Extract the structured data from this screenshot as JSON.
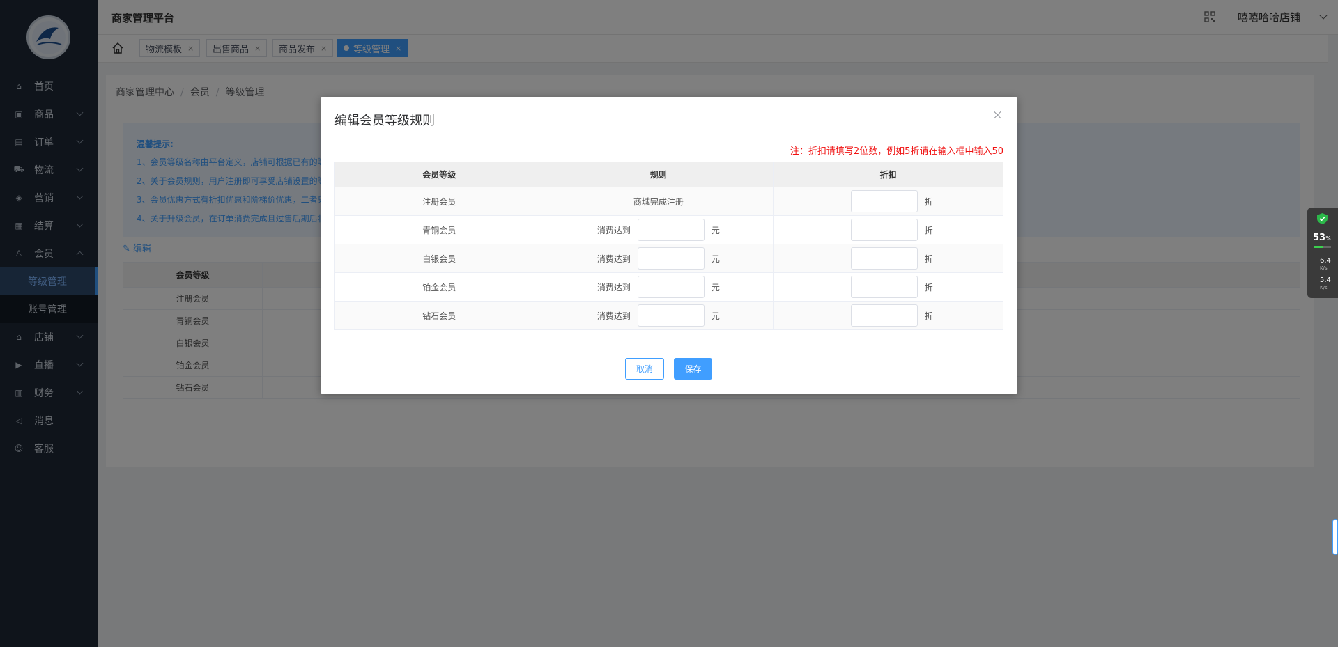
{
  "header": {
    "title": "商家管理平台",
    "shop_name": "嘻嘻哈哈店铺"
  },
  "sidebar": {
    "items": [
      {
        "label": "首页",
        "icon": "home-icon"
      },
      {
        "label": "商品",
        "icon": "goods-icon"
      },
      {
        "label": "订单",
        "icon": "order-icon"
      },
      {
        "label": "物流",
        "icon": "truck-icon"
      },
      {
        "label": "营销",
        "icon": "tag-icon"
      },
      {
        "label": "结算",
        "icon": "settle-icon"
      },
      {
        "label": "会员",
        "icon": "user-icon"
      },
      {
        "label": "店铺",
        "icon": "shop-icon"
      },
      {
        "label": "直播",
        "icon": "live-icon"
      },
      {
        "label": "财务",
        "icon": "finance-icon"
      },
      {
        "label": "消息",
        "icon": "sound-icon"
      },
      {
        "label": "客服",
        "icon": "service-icon"
      }
    ],
    "member_sub": [
      {
        "label": "等级管理"
      },
      {
        "label": "账号管理"
      }
    ]
  },
  "tabs": [
    {
      "label": "物流模板"
    },
    {
      "label": "出售商品"
    },
    {
      "label": "商品发布"
    },
    {
      "label": "等级管理"
    }
  ],
  "breadcrumb": [
    "商家管理中心",
    "会员",
    "等级管理"
  ],
  "tips": {
    "title": "温馨提示:",
    "lines": [
      "1、会员等级名称由平台定义，店铺可根据已有的等",
      "2、关于会员规则，用户注册即可享受店铺设置的等",
      "3、会员优惠方式有折扣优惠和阶梯价优惠，二者只",
      "4、关于升级会员，在订单消费完成且过售后期后将"
    ]
  },
  "edit_label": "编辑",
  "bg_table": {
    "header": "会员等级",
    "rows": [
      "注册会员",
      "青铜会员",
      "白银会员",
      "铂金会员",
      "钻石会员"
    ]
  },
  "dialog": {
    "title": "编辑会员等级规则",
    "note": "注：折扣请填写2位数，例如5折请在输入框中输入50",
    "columns": [
      "会员等级",
      "规则",
      "折扣"
    ],
    "rows": [
      {
        "level": "注册会员",
        "rule": "商城完成注册"
      },
      {
        "level": "青铜会员",
        "rule_prefix": "消费达到",
        "unit": "元"
      },
      {
        "level": "白银会员",
        "rule_prefix": "消费达到",
        "unit": "元"
      },
      {
        "level": "铂金会员",
        "rule_prefix": "消费达到",
        "unit": "元"
      },
      {
        "level": "钻石会员",
        "rule_prefix": "消费达到",
        "unit": "元"
      }
    ],
    "discount_unit": "折",
    "cancel_label": "取消",
    "save_label": "保存"
  },
  "net_widget": {
    "percent": "53",
    "percent_unit": "%",
    "up": "6.4",
    "down": "5.4",
    "speed_unit": "K/s"
  }
}
